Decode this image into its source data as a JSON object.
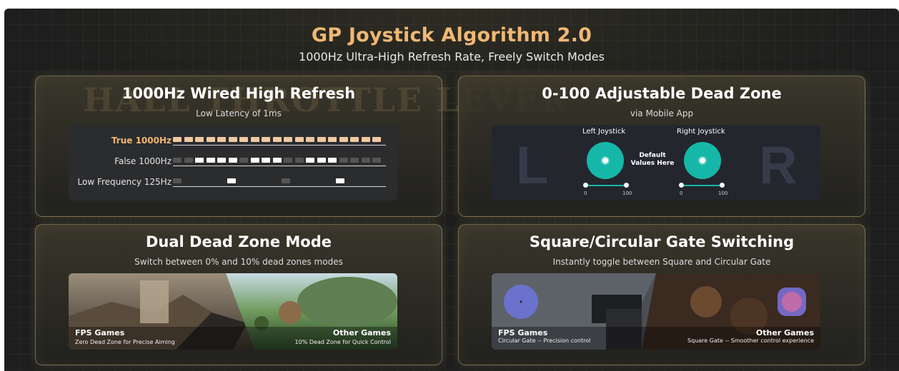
{
  "header": {
    "title": "GP Joystick Algorithm 2.0",
    "subtitle": "1000Hz Ultra-High Refresh Rate, Freely Switch Modes"
  },
  "cards": {
    "refresh": {
      "title": "1000Hz Wired High Refresh",
      "subtitle": "Low Latency of 1ms",
      "watermark": "HALL THROTTLE LEVER",
      "rows": [
        {
          "label": "True 1000Hz",
          "color": "#f2c9a1"
        },
        {
          "label": "False 1000Hz",
          "color": "#ffffff"
        },
        {
          "label": "Low Frequency 125Hz",
          "color": "#ffffff"
        }
      ]
    },
    "deadzone": {
      "title": "0-100 Adjustable Dead Zone",
      "subtitle": "via Mobile App",
      "left_letter": "L",
      "right_letter": "R",
      "left_label": "Left Joystick",
      "right_label": "Right Joystick",
      "default_label": "Default Values Here",
      "slider_min": "0",
      "slider_max": "100",
      "accent": "#15b8a8"
    },
    "dual": {
      "title": "Dual Dead Zone Mode",
      "subtitle": "Switch between 0% and 10% dead zones modes",
      "left_title": "FPS Games",
      "left_desc": "Zero Dead Zone for Precise Aiming",
      "right_title": "Other Games",
      "right_desc": "10% Dead Zone for Quick Control"
    },
    "gate": {
      "title": "Square/Circular Gate Switching",
      "subtitle": "Instantly toggle between Square and Circular Gate",
      "left_title": "FPS Games",
      "left_desc": "Circular Gate -- Precision control",
      "right_title": "Other Games",
      "right_desc": "Square Gate -- Smoother control experience"
    }
  },
  "colors": {
    "title_gold": "#f0b774",
    "card_border": "#d6ba82",
    "teal": "#15b8a8"
  }
}
